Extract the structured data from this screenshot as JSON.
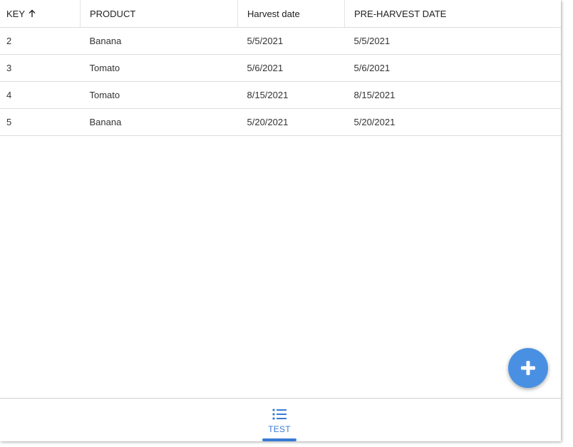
{
  "table": {
    "headers": {
      "key": "KEY",
      "product": "PRODUCT",
      "harvest": "Harvest date",
      "pre_harvest": "PRE-HARVEST DATE"
    },
    "sort": {
      "column": "key",
      "direction": "ascending"
    },
    "rows": [
      {
        "key": "2",
        "product": "Banana",
        "harvest": "5/5/2021",
        "pre_harvest": "5/5/2021"
      },
      {
        "key": "3",
        "product": "Tomato",
        "harvest": "5/6/2021",
        "pre_harvest": "5/6/2021"
      },
      {
        "key": "4",
        "product": "Tomato",
        "harvest": "8/15/2021",
        "pre_harvest": "8/15/2021"
      },
      {
        "key": "5",
        "product": "Banana",
        "harvest": "5/20/2021",
        "pre_harvest": "5/20/2021"
      }
    ]
  },
  "fab": {
    "icon": "plus-icon"
  },
  "bottom_nav": {
    "tabs": [
      {
        "label": "TEST",
        "icon": "list-icon",
        "active": true
      }
    ]
  },
  "colors": {
    "accent": "#3a7bd5",
    "fab": "#4a90e2",
    "divider": "#dddddd"
  }
}
